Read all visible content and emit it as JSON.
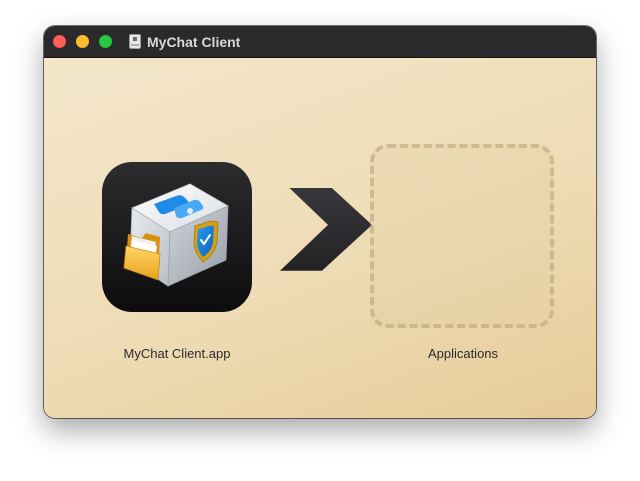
{
  "window": {
    "title": "MyChat Client",
    "title_icon": "disk-image-icon"
  },
  "installer": {
    "app_label": "MyChat Client.app",
    "app_icon": "mychat-client-app-icon",
    "arrow_icon": "chevron-right-arrow-icon",
    "destination_label": "Applications"
  },
  "colors": {
    "titlebar": "#2a2a2c",
    "background": "#efdeba",
    "close": "#fe5f57",
    "minimize": "#febc2e",
    "zoom": "#28c840",
    "arrow": "#2e2d30",
    "dashed_border": "#c9b28a"
  }
}
